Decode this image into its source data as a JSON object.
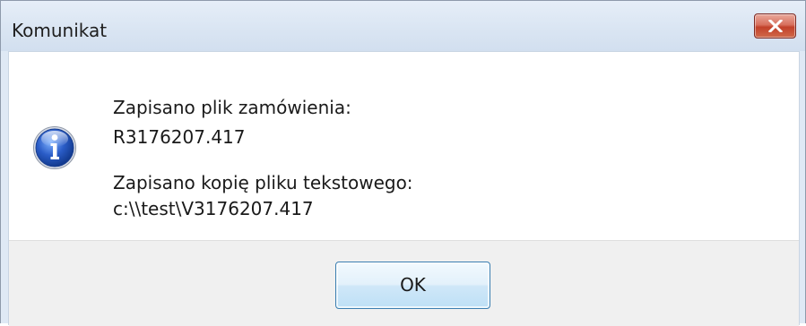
{
  "window": {
    "title": "Komunikat",
    "close_icon": "close-icon"
  },
  "message": {
    "icon": "info-icon",
    "line1": "Zapisano plik zamówienia:",
    "line2": "R3176207.417",
    "line3": "Zapisano kopię pliku tekstowego:",
    "line4": "c:\\\\test\\V3176207.417"
  },
  "footer": {
    "ok_label": "OK"
  },
  "colors": {
    "close_button": "#c9503a",
    "info_icon_blue": "#2a5cc7",
    "ok_border": "#3c7fb1"
  }
}
